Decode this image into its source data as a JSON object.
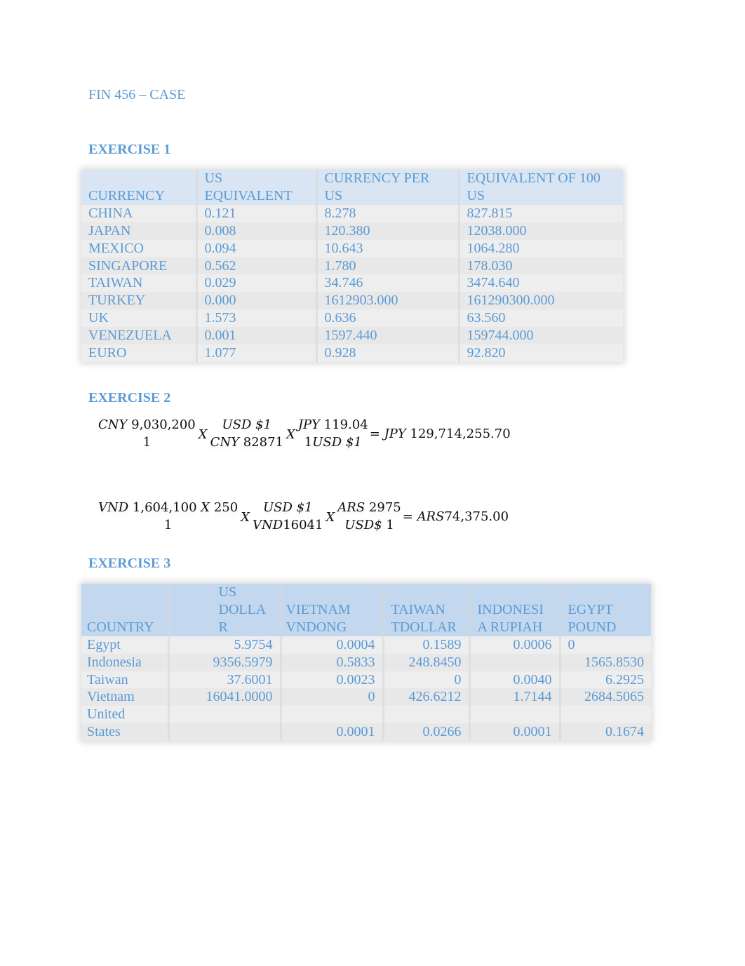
{
  "title": "FIN 456 – CASE",
  "exercise1": {
    "heading": "EXERCISE 1",
    "headers": [
      [
        "",
        "CURRENCY"
      ],
      [
        "US",
        "EQUIVALENT"
      ],
      [
        "CURRENCY PER",
        "US"
      ],
      [
        "EQUIVALENT OF 100",
        "US"
      ]
    ],
    "rows": [
      [
        "CHINA",
        "0.121",
        "8.278",
        "827.815"
      ],
      [
        "JAPAN",
        "0.008",
        "120.380",
        "12038.000"
      ],
      [
        "MEXICO",
        "0.094",
        "10.643",
        "1064.280"
      ],
      [
        "SINGAPORE",
        "0.562",
        "1.780",
        "178.030"
      ],
      [
        "TAIWAN",
        "0.029",
        "34.746",
        "3474.640"
      ],
      [
        "TURKEY",
        "0.000",
        "1612903.000",
        "161290300.000"
      ],
      [
        "UK",
        "1.573",
        "0.636",
        "63.560"
      ],
      [
        "VENEZUELA",
        "0.001",
        "1597.440",
        "159744.000"
      ],
      [
        "EURO",
        "1.077",
        "0.928",
        "92.820"
      ]
    ]
  },
  "exercise2": {
    "heading": "EXERCISE 2",
    "eq1": {
      "f1_num_cur": "CNY",
      "f1_num_val": "9,030,200",
      "f1_den": "1",
      "op1": "X",
      "f2_num_cur": "USD",
      "f2_num_val": "$1",
      "f2_den_cur": "CNY",
      "f2_den_val": "82871",
      "op2": "X",
      "f3_num_cur": "JPY",
      "f3_num_val": "119.04",
      "f3_den_pre": "1",
      "f3_den_cur": "USD",
      "f3_den_val": "$1",
      "eq": "=",
      "res_cur": "JPY",
      "res_val": "129,714,255.70"
    },
    "eq2": {
      "f1_num_cur": "VND",
      "f1_num_val": "1,604,100",
      "f1_num_x": "X",
      "f1_num_mult": "250",
      "f1_den": "1",
      "op1": "X",
      "f2_num_cur": "USD",
      "f2_num_val": "$1",
      "f2_den_cur": "VND",
      "f2_den_val": "16041",
      "op2": "X",
      "f3_num_cur": "ARS",
      "f3_num_val": "2975",
      "f3_den_cur": "USD$",
      "f3_den_val": "1",
      "eq": "=",
      "res_cur": "ARS",
      "res_val": "74,375.00"
    }
  },
  "exercise3": {
    "heading": "EXERCISE 3",
    "headers": [
      [
        "",
        "",
        "COUNTRY"
      ],
      [
        "US",
        "DOLLA",
        "R"
      ],
      [
        "",
        "VIETNAM",
        "VNDONG"
      ],
      [
        "",
        "TAIWAN",
        "TDOLLAR"
      ],
      [
        "",
        "INDONESI",
        "A RUPIAH"
      ],
      [
        "",
        "EGYPT",
        "POUND"
      ]
    ],
    "rows": [
      [
        "Egypt",
        "5.9754",
        "0.0004",
        "0.1589",
        "0.0006",
        "0"
      ],
      [
        "Indonesia",
        "9356.5979",
        "0.5833",
        "248.8450",
        "",
        "1565.8530"
      ],
      [
        "Taiwan",
        "37.6001",
        "0.0023",
        "0",
        "0.0040",
        "6.2925"
      ],
      [
        "Vietnam",
        "16041.0000",
        "0",
        "426.6212",
        "1.7144",
        "2684.5065"
      ],
      [
        "United",
        "",
        "",
        "",
        "",
        ""
      ],
      [
        "States",
        "",
        "0.0001",
        "0.0266",
        "0.0001",
        "0.1674"
      ]
    ]
  }
}
